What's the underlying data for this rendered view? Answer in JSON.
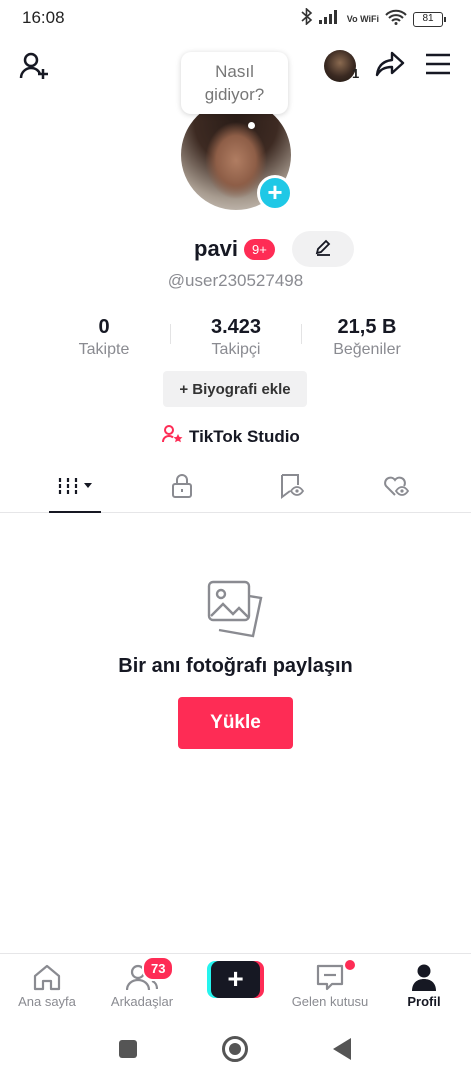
{
  "status_bar": {
    "time": "16:08",
    "network": "Vo WiFi",
    "battery": "81"
  },
  "header": {
    "notifications_count": "1"
  },
  "bubble": {
    "line1": "Nasıl",
    "line2": "gidiyor?"
  },
  "profile": {
    "name": "pavi",
    "badge": "9+",
    "username": "@user230527498",
    "stats": [
      {
        "value": "0",
        "label": "Takipte"
      },
      {
        "value": "3.423",
        "label": "Takipçi"
      },
      {
        "value": "21,5 B",
        "label": "Beğeniler"
      }
    ],
    "bio_button": "+ Biyografi ekle",
    "studio_label": "TikTok Studio"
  },
  "empty_state": {
    "title": "Bir anı fotoğrafı paylaşın",
    "button": "Yükle"
  },
  "bottom_nav": {
    "home": "Ana sayfa",
    "friends": "Arkadaşlar",
    "friends_badge": "73",
    "create": "+",
    "inbox": "Gelen kutusu",
    "profile": "Profil"
  },
  "colors": {
    "accent": "#fe2c55",
    "cyan": "#25f4ee",
    "add_button": "#1fc8e6"
  }
}
